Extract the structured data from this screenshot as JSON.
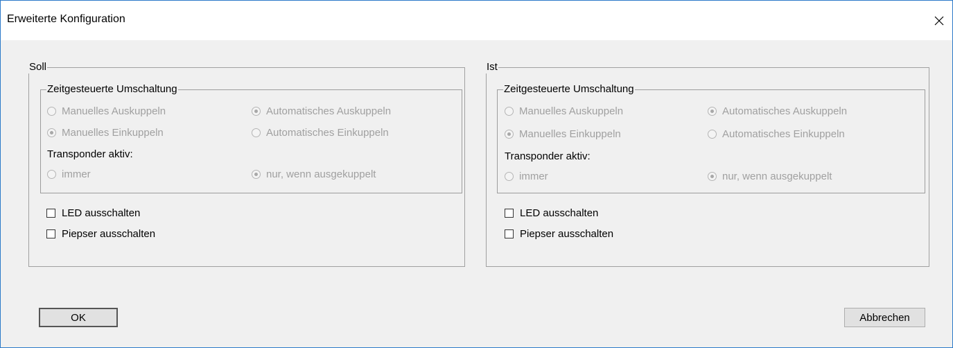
{
  "window": {
    "title": "Erweiterte Konfiguration",
    "close_glyph": "✕"
  },
  "panels": {
    "soll": {
      "label": "Soll",
      "group_label": "Zeitgesteuerte Umschaltung",
      "options": {
        "manual_decouple": "Manuelles Auskuppeln",
        "auto_decouple": "Automatisches Auskuppeln",
        "manual_couple": "Manuelles Einkuppeln",
        "auto_couple": "Automatisches Einkuppeln"
      },
      "transponder_label": "Transponder aktiv:",
      "transponder_options": {
        "always": "immer",
        "only_decoupled": "nur, wenn ausgekuppelt"
      },
      "checkboxes": {
        "led": "LED ausschalten",
        "beeper": "Piepser ausschalten"
      }
    },
    "ist": {
      "label": "Ist",
      "group_label": "Zeitgesteuerte Umschaltung",
      "options": {
        "manual_decouple": "Manuelles Auskuppeln",
        "auto_decouple": "Automatisches Auskuppeln",
        "manual_couple": "Manuelles Einkuppeln",
        "auto_couple": "Automatisches Einkuppeln"
      },
      "transponder_label": "Transponder aktiv:",
      "transponder_options": {
        "always": "immer",
        "only_decoupled": "nur, wenn ausgekuppelt"
      },
      "checkboxes": {
        "led": "LED ausschalten",
        "beeper": "Piepser ausschalten"
      }
    }
  },
  "buttons": {
    "ok": "OK",
    "cancel": "Abbrechen"
  },
  "colors": {
    "dialog_bg": "#f0f0f0",
    "window_border": "#2b79c9",
    "disabled_text": "#a0a0a0"
  }
}
